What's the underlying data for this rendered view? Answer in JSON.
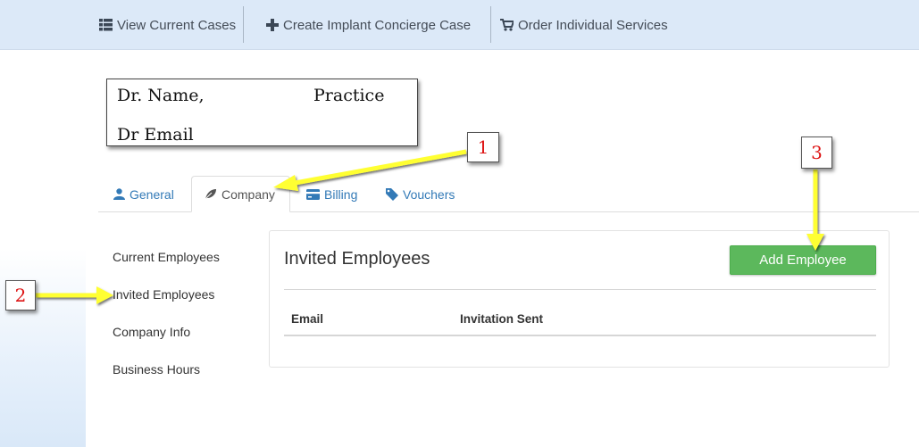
{
  "nav": {
    "items": [
      {
        "label": "View Current Cases",
        "icon": "list-icon"
      },
      {
        "label": "Create Implant Concierge Case",
        "icon": "plus-icon"
      },
      {
        "label": "Order Individual Services",
        "icon": "cart-icon"
      }
    ]
  },
  "profile": {
    "name": "Dr. Name,",
    "practice": "Practice",
    "email": "Dr Email"
  },
  "tabs": [
    {
      "label": "General",
      "icon": "user-icon"
    },
    {
      "label": "Company",
      "icon": "leaf-icon",
      "active": true
    },
    {
      "label": "Billing",
      "icon": "credit-card-icon"
    },
    {
      "label": "Vouchers",
      "icon": "tag-icon"
    }
  ],
  "side_menu": [
    "Current Employees",
    "Invited Employees",
    "Company Info",
    "Business Hours"
  ],
  "panel": {
    "title": "Invited Employees",
    "add_button": "Add Employee",
    "columns": [
      "Email",
      "Invitation Sent"
    ]
  },
  "annotations": [
    "1",
    "2",
    "3"
  ],
  "colors": {
    "nav_bg": "#dce9f8",
    "link": "#337ab7",
    "button_green": "#5cb85c",
    "arrow_yellow": "#ffff33",
    "callout_text": "#dd1111"
  }
}
